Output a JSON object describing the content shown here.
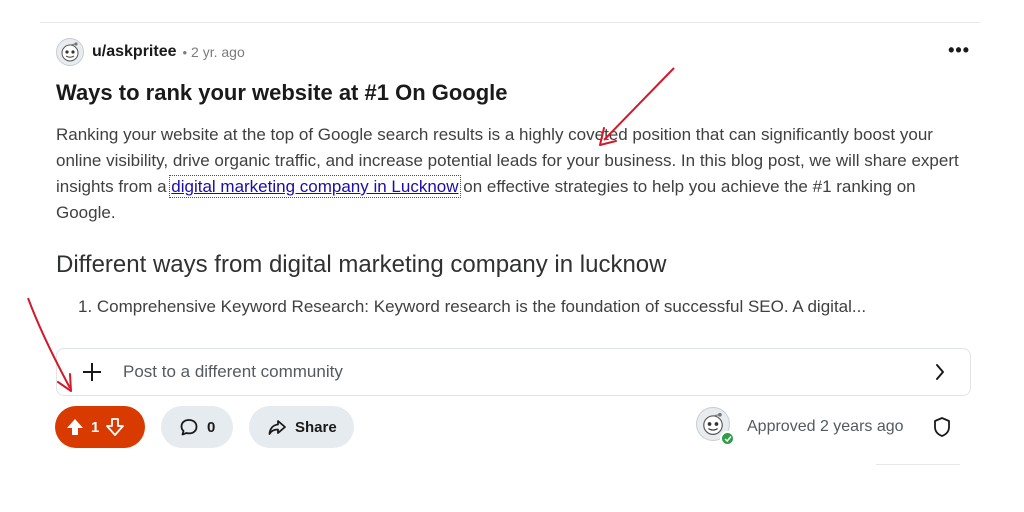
{
  "post": {
    "username": "u/askpritee",
    "separator": "•",
    "timestamp": "2 yr. ago",
    "more_label": "•••",
    "title": "Ways to rank your website at #1 On Google",
    "body_part1": "Ranking your website at the top of Google search results is a highly coveted position that can significantly boost your online visibility, drive organic traffic, and increase potential leads for your business. In this blog post, we will share expert insights from a ",
    "body_link": "digital marketing company in Lucknow",
    "body_part2": " on effective strategies to help you achieve the #1 ranking on Google.",
    "section_heading": "Different ways from digital marketing company in lucknow",
    "list_item": "1. Comprehensive Keyword Research: Keyword research is the foundation of successful SEO. A digital..."
  },
  "community": {
    "label": "Post to a different community"
  },
  "actions": {
    "upvote_count": "1",
    "comment_count": "0",
    "share_label": "Share"
  },
  "moderation": {
    "approved_text": "Approved 2 years ago"
  },
  "icons": [
    "snoo-avatar-icon",
    "more-options-icon",
    "plus-icon",
    "chevron-right-icon",
    "upvote-arrow-icon",
    "downvote-arrow-icon",
    "comment-bubble-icon",
    "share-arrow-icon",
    "check-badge-icon",
    "shield-icon"
  ],
  "colors": {
    "upvote_active": "#d93a00",
    "pill_bg": "#e5ebee",
    "link": "#1a0dab",
    "annotation": "#d11a2a",
    "approved_badge": "#2e9e46"
  }
}
